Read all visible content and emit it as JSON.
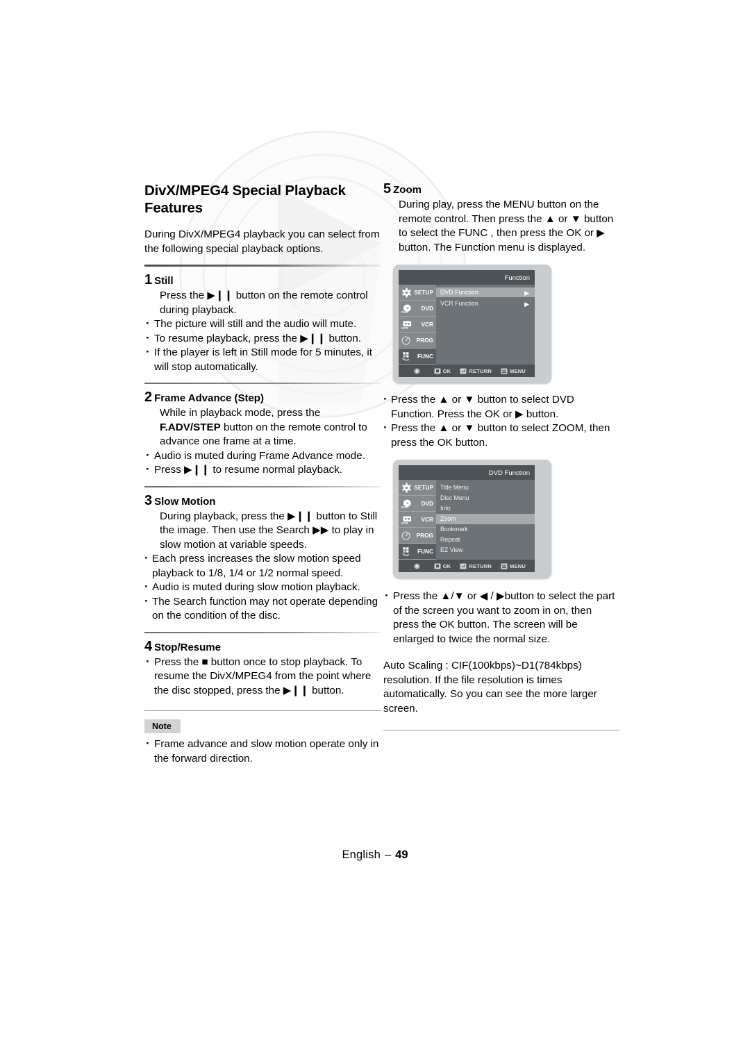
{
  "page": {
    "language": "English",
    "dash": "–",
    "number": "49"
  },
  "left_column": {
    "heading": "DivX/MPEG4 Special Playback Features",
    "intro": "During DivX/MPEG4 playback you can select from the following special playback options.",
    "steps": [
      {
        "number": "1",
        "title": "Still",
        "body": "Press the ▶❙❙ button on the remote control during playback.",
        "bullets": [
          "The picture will still and the audio will mute.",
          "To resume playback, press the ▶❙❙ button.",
          "If the player is left in Still mode for 5 minutes, it will stop automatically."
        ]
      },
      {
        "number": "2",
        "title": "Frame Advance (Step)",
        "body_pre": "While in playback mode, press the ",
        "body_bold": "F.ADV/STEP",
        "body_post": " button on the remote control to advance one frame at a time.",
        "bullets": [
          "Audio is muted during Frame Advance mode.",
          "Press ▶❙❙ to resume normal playback."
        ]
      },
      {
        "number": "3",
        "title": "Slow Motion",
        "body": "During playback, press the ▶❙❙ button to Still the image. Then use the Search ▶▶ to play in slow motion at variable speeds.",
        "bullets": [
          "Each press increases the slow motion speed playback to 1/8, 1/4 or 1/2 normal speed.",
          "Audio is muted during slow motion playback.",
          "The Search function may not operate depending on the condition of the disc."
        ]
      },
      {
        "number": "4",
        "title": "Stop/Resume",
        "bullets": [
          "Press the ■ button once to stop playback. To resume the DivX/MPEG4 from the point where the disc stopped, press the ▶❙❙ button."
        ]
      }
    ],
    "note": {
      "label": "Note",
      "items": [
        "Frame advance and slow motion operate only in the forward direction."
      ]
    }
  },
  "right_column": {
    "step": {
      "number": "5",
      "title": "Zoom",
      "body": "During play, press the MENU button on the remote control. Then press the ▲ or ▼ button to select the FUNC , then press the OK or ▶ button. The Function menu is displayed."
    },
    "bullets_mid": [
      "Press the ▲ or ▼ button to select DVD Function. Press the OK or ▶ button.",
      "Press the ▲ or ▼ button to select ZOOM, then press the OK button."
    ],
    "bullets_bottom": [
      "Press the ▲/▼ or ◀ / ▶button to select the part of the screen you want to zoom in on, then press the OK button. The screen will be enlarged to twice the normal size."
    ],
    "auto_scaling": {
      "label": "Auto Scaling :",
      "text": "CIF(100kbps)~D1(784kbps) resolution. If the file resolution is times automatically. So you can see the more larger screen."
    }
  },
  "osd_function": {
    "title": "Function",
    "tabs": [
      {
        "label": "SETUP",
        "icon": "gear-icon",
        "selected": false
      },
      {
        "label": "DVD",
        "icon": "disc-icon",
        "selected": false
      },
      {
        "label": "VCR",
        "icon": "cassette-icon",
        "selected": false
      },
      {
        "label": "PROG",
        "icon": "timer-icon",
        "selected": false
      },
      {
        "label": "FUNC",
        "icon": "remote-icon",
        "selected": true
      }
    ],
    "items": [
      {
        "label": "DVD Function",
        "highlighted": true,
        "arrow": "▶"
      },
      {
        "label": "VCR Function",
        "highlighted": false,
        "arrow": "▶"
      }
    ],
    "footer": [
      {
        "label": "OK",
        "icon": "ok-button-icon"
      },
      {
        "label": "RETURN",
        "icon": "return-button-icon"
      },
      {
        "label": "MENU",
        "icon": "menu-button-icon"
      }
    ],
    "dpad_icon": "dpad-icon"
  },
  "osd_dvd_function": {
    "title": "DVD Function",
    "tabs": [
      {
        "label": "SETUP",
        "icon": "gear-icon",
        "selected": false
      },
      {
        "label": "DVD",
        "icon": "disc-icon",
        "selected": false
      },
      {
        "label": "VCR",
        "icon": "cassette-icon",
        "selected": false
      },
      {
        "label": "PROG",
        "icon": "timer-icon",
        "selected": false
      },
      {
        "label": "FUNC",
        "icon": "remote-icon",
        "selected": true
      }
    ],
    "items": [
      {
        "label": "Title Menu",
        "highlighted": false
      },
      {
        "label": "Disc Menu",
        "highlighted": false
      },
      {
        "label": "Info",
        "highlighted": false
      },
      {
        "label": "Zoom",
        "highlighted": true
      },
      {
        "label": "Bookmark",
        "highlighted": false
      },
      {
        "label": "Repeat",
        "highlighted": false
      },
      {
        "label": "EZ View",
        "highlighted": false
      }
    ],
    "footer": [
      {
        "label": "OK",
        "icon": "ok-button-icon"
      },
      {
        "label": "RETURN",
        "icon": "return-button-icon"
      },
      {
        "label": "MENU",
        "icon": "menu-button-icon"
      }
    ],
    "dpad_icon": "dpad-icon"
  }
}
